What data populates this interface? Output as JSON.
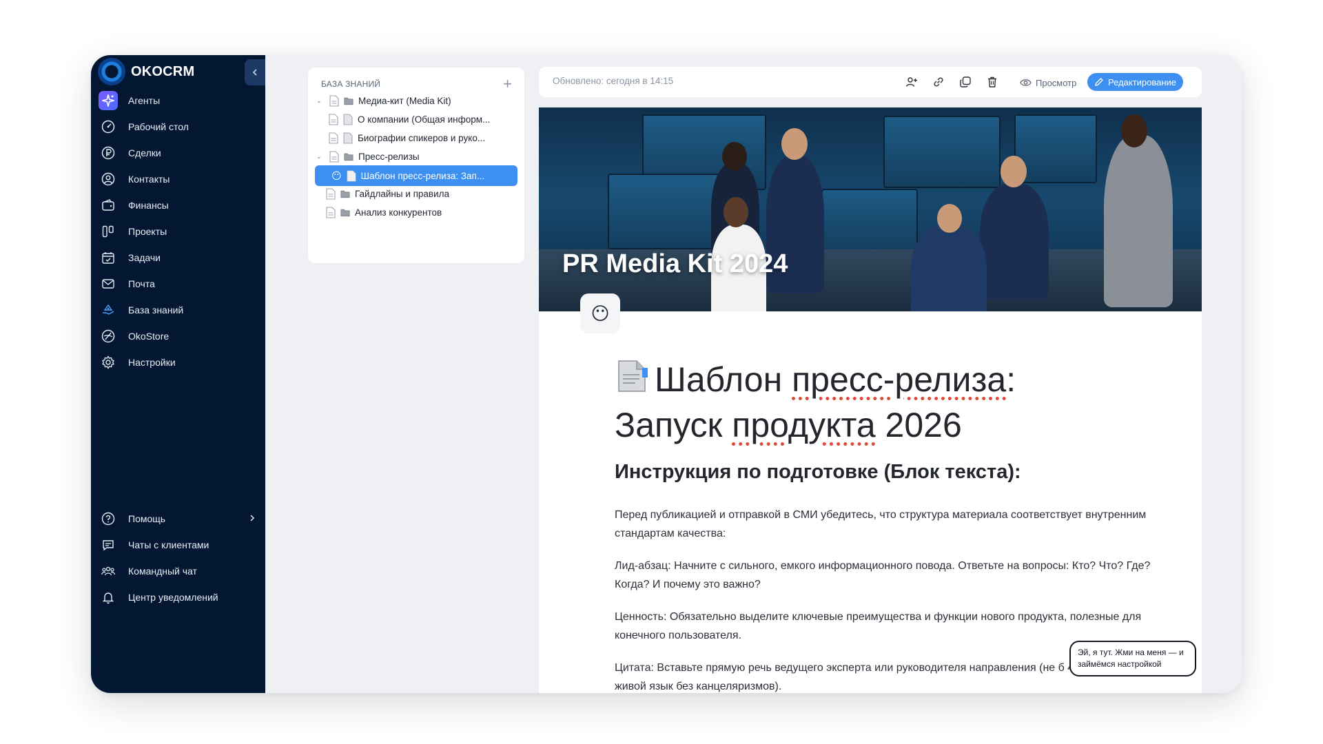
{
  "brand": {
    "name": "OKOCRM"
  },
  "sidebar": {
    "items": [
      {
        "label": "Агенты",
        "icon": "sparkle-icon"
      },
      {
        "label": "Рабочий стол",
        "icon": "dashboard-gauge-icon"
      },
      {
        "label": "Сделки",
        "icon": "ruble-icon"
      },
      {
        "label": "Контакты",
        "icon": "user-circle-icon"
      },
      {
        "label": "Финансы",
        "icon": "wallet-icon"
      },
      {
        "label": "Проекты",
        "icon": "kanban-icon"
      },
      {
        "label": "Задачи",
        "icon": "calendar-check-icon"
      },
      {
        "label": "Почта",
        "icon": "mail-icon"
      },
      {
        "label": "База знаний",
        "icon": "knowledge-hand-icon"
      },
      {
        "label": "OkoStore",
        "icon": "store-icon"
      },
      {
        "label": "Настройки",
        "icon": "gear-icon"
      }
    ],
    "bottom": [
      {
        "label": "Помощь",
        "icon": "help-circle-icon"
      },
      {
        "label": "Чаты с клиентами",
        "icon": "chat-icon"
      },
      {
        "label": "Командный чат",
        "icon": "team-icon"
      },
      {
        "label": "Центр уведомлений",
        "icon": "bell-icon"
      }
    ]
  },
  "tree": {
    "header": "БАЗА ЗНАНИЙ",
    "add": "+",
    "items": [
      {
        "label": "Медиа-кит (Media Kit)",
        "level": 0,
        "expanded": true
      },
      {
        "label": "О компании (Общая информ...",
        "level": 1
      },
      {
        "label": "Биографии спикеров и руко...",
        "level": 1
      },
      {
        "label": "Пресс-релизы",
        "level": 0,
        "expanded": true
      },
      {
        "label": "Шаблон пресс-релиза: Зап...",
        "level": 1,
        "active": true,
        "emoji": "😶"
      },
      {
        "label": "Гайдлайны и правила",
        "level": 0
      },
      {
        "label": "Анализ конкурентов",
        "level": 0
      }
    ]
  },
  "toolbar": {
    "updated": "Обновлено: сегодня в 14:15",
    "view_label": "Просмотр",
    "edit_label": "Редактирование"
  },
  "document": {
    "cover_title": "PR Media Kit 2024",
    "emoji": "😶",
    "title_line1_a": "Шаблон ",
    "title_line1_b": "пресс-релиза",
    "title_line1_c": ":",
    "title_line2_a": "Запуск ",
    "title_line2_b": "продукта",
    "title_line2_c": " 2026",
    "heading": "Инструкция по подготовке (Блок текста):",
    "paragraphs": [
      "Перед публикацией и отправкой в СМИ убедитесь, что структура материала соответствует внутренним стандартам качества:",
      "Лид-абзац: Начните с сильного, емкого информационного повода. Ответьте на вопросы: Кто? Что? Где? Когда? И почему это важно?",
      "Ценность: Обязательно выделите ключевые преимущества и функции нового продукта, полезные для конечного пользователя.",
      "Цитата: Вставьте прямую речь ведущего эксперта или руководителя направления (не б 4 предложений, живой язык без канцеляризмов)."
    ]
  },
  "tooltip": {
    "text": "Эй, я тут. Жми на меня — и займёмся настройкой"
  },
  "colors": {
    "sidebar_bg": "#031733",
    "accent": "#3d8ff0",
    "canvas_bg": "#eef0f4"
  }
}
